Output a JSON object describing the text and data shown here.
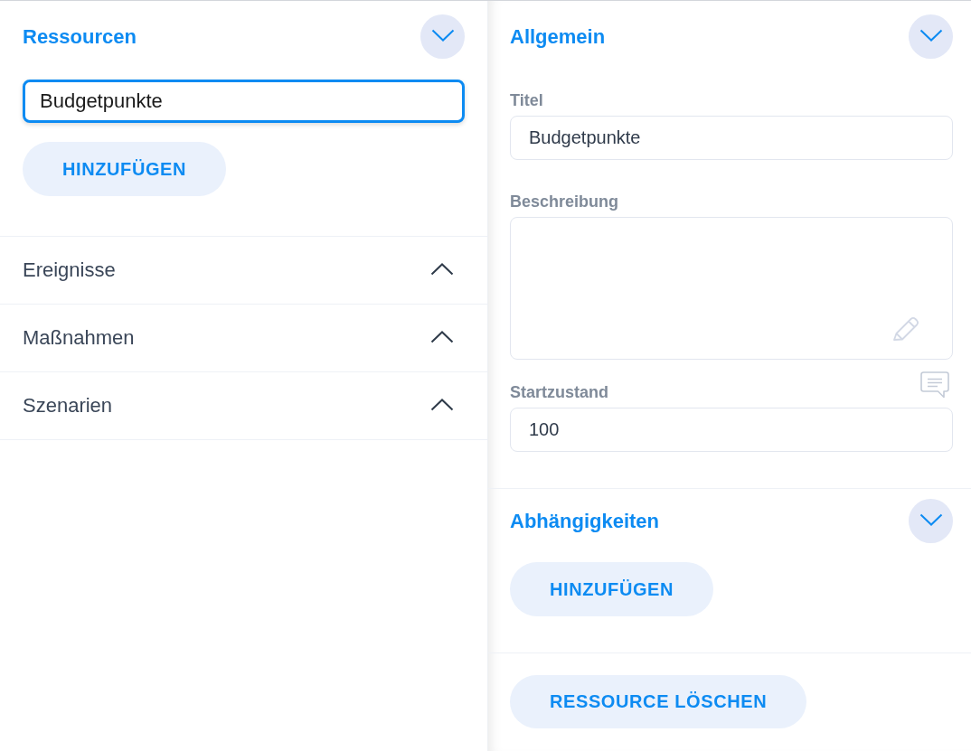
{
  "resources_panel": {
    "sections": [
      {
        "title": "Ressourcen",
        "expanded": true,
        "input": {
          "value": "Budgetpunkte",
          "focused": true
        },
        "button": "HINZUFÜGEN"
      },
      {
        "title": "Ereignisse",
        "expanded": false
      },
      {
        "title": "Maßnahmen",
        "expanded": false
      },
      {
        "title": "Szenarien",
        "expanded": false
      }
    ]
  },
  "detail_panel": {
    "sections": [
      {
        "title": "Allgemein",
        "expanded": true,
        "fields": [
          {
            "kind": "text",
            "label": "Titel",
            "value": "Budgetpunkte"
          },
          {
            "kind": "textarea",
            "label": "Beschreibung"
          },
          {
            "kind": "number",
            "label": "Startzustand",
            "value": "100"
          }
        ]
      },
      {
        "title": "Abhängigkeiten",
        "expanded": true,
        "button": "HINZUFÜGEN"
      }
    ],
    "delete_button": "RESSOURCE LÖSCHEN"
  }
}
